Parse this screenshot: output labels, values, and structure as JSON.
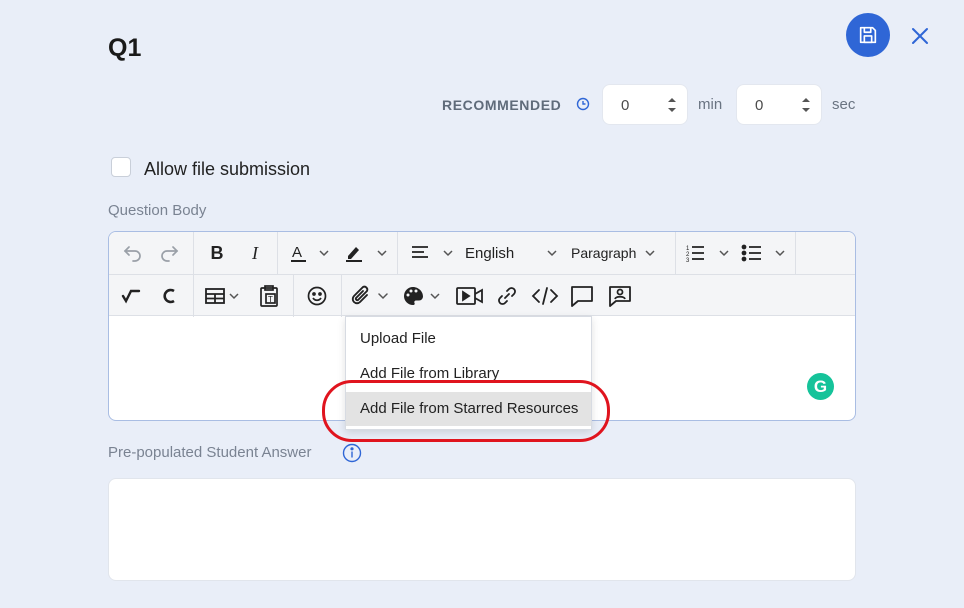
{
  "question": {
    "title": "Q1"
  },
  "header": {
    "save_icon": "floppy-disk-icon",
    "close_icon": "close-icon",
    "accent_color": "#2f66d6"
  },
  "recommended": {
    "label": "RECOMMENDED",
    "icon": "clock-icon",
    "minutes": "0",
    "minutes_unit": "min",
    "seconds": "0",
    "seconds_unit": "sec"
  },
  "allow_file_submission": {
    "label": "Allow file submission",
    "checked": false
  },
  "question_body": {
    "label": "Question Body",
    "toolbar": {
      "language": "English",
      "block_format": "Paragraph",
      "icons_row1": [
        "undo-icon",
        "redo-icon",
        "bold-icon",
        "italic-icon",
        "font-color-icon",
        "highlight-color-icon",
        "align-icon",
        "numbered-list-icon",
        "bulleted-list-icon"
      ],
      "icons_row2": [
        "math-icon",
        "chemistry-icon",
        "table-icon",
        "paste-text-icon",
        "emoji-icon",
        "attachment-icon",
        "palette-icon",
        "video-icon",
        "link-icon",
        "code-icon",
        "comment-icon",
        "image-comment-icon"
      ]
    }
  },
  "attach_menu": {
    "items": [
      "Upload File",
      "Add File from Library",
      "Add File from Starred Resources"
    ],
    "highlighted": "Add File from Starred Resources",
    "annotation_color": "#e0141e"
  },
  "pre_populated": {
    "label": "Pre-populated Student Answer",
    "icon": "info-icon"
  },
  "grammarly": {
    "letter": "G",
    "color": "#15c39a"
  }
}
